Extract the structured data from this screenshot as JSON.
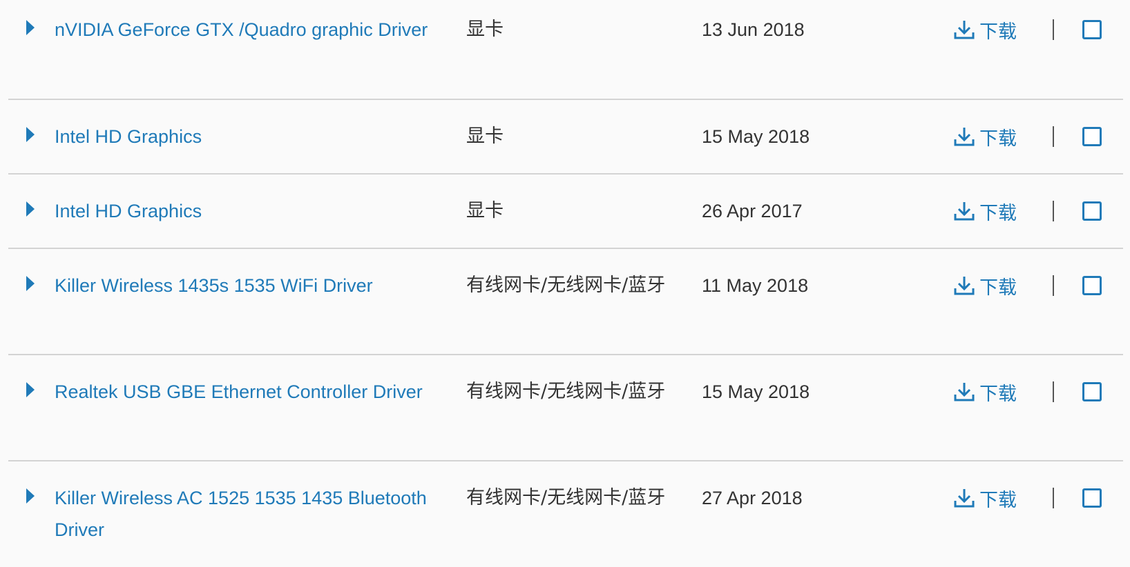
{
  "drivers": [
    {
      "name": "nVIDIA GeForce GTX /Quadro graphic Driver",
      "category": "显卡",
      "date": "13 Jun 2018",
      "download_label": "下载"
    },
    {
      "name": "Intel HD Graphics",
      "category": "显卡",
      "date": "15 May 2018",
      "download_label": "下载"
    },
    {
      "name": "Intel HD Graphics",
      "category": "显卡",
      "date": "26 Apr 2017",
      "download_label": "下载"
    },
    {
      "name": "Killer Wireless 1435s 1535 WiFi Driver",
      "category": "有线网卡/无线网卡/蓝牙",
      "date": "11 May 2018",
      "download_label": "下载"
    },
    {
      "name": "Realtek USB GBE Ethernet Controller Driver",
      "category": "有线网卡/无线网卡/蓝牙",
      "date": "15 May 2018",
      "download_label": "下载"
    },
    {
      "name": "Killer Wireless AC 1525 1535 1435 Bluetooth Driver",
      "category": "有线网卡/无线网卡/蓝牙",
      "date": "27 Apr 2018",
      "download_label": "下载"
    }
  ],
  "icons": {
    "expand": "caret-right-icon",
    "download": "download-icon"
  },
  "colors": {
    "link": "#1f7ab8",
    "text": "#333333",
    "divider": "#d3d3d3",
    "background": "#fafafa"
  }
}
